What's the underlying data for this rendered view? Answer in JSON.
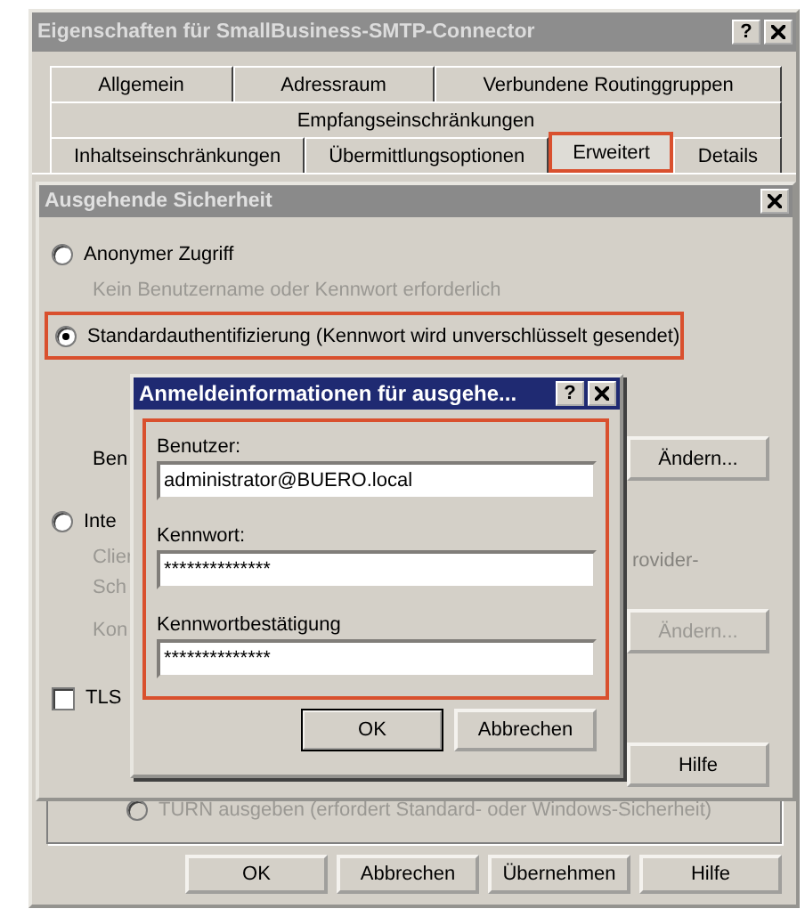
{
  "window": {
    "title": "Eigenschaften für SmallBusiness-SMTP-Connector",
    "help_button": "?"
  },
  "tab_rows": [
    [
      {
        "label": "Allgemein",
        "selected": false
      },
      {
        "label": "Adressraum",
        "selected": false
      },
      {
        "label": "Verbundene Routinggruppen",
        "selected": false
      }
    ],
    [
      {
        "label": "Empfangseinschränkungen",
        "selected": false
      }
    ],
    [
      {
        "label": "Inhaltseinschränkungen",
        "selected": false
      },
      {
        "label": "Übermittlungsoptionen",
        "selected": false
      },
      {
        "label": "Erweitert",
        "selected": true
      },
      {
        "label": "Details",
        "selected": false
      }
    ]
  ],
  "turn_option": {
    "label": "TURN ausgeben (erfordert Standard- oder Windows-Sicherheit)",
    "disabled": true
  },
  "buttons": [
    {
      "label": "OK"
    },
    {
      "label": "Abbrechen"
    },
    {
      "label": "Übernehmen"
    },
    {
      "label": "Hilfe"
    }
  ],
  "security_dialog": {
    "title": "Ausgehende Sicherheit",
    "anonymous": {
      "label": "Anonymer Zugriff",
      "selected": false,
      "description": "Kein Benutzername oder Kennwort erforderlich"
    },
    "basic": {
      "label": "Standardauthentifizierung (Kennwort wird unverschlüsselt gesendet)",
      "selected": true
    },
    "basic_user_label": "Ben",
    "integrated": {
      "label": "Inte",
      "selected": false,
      "description_lines": [
        "Clier",
        "Sch"
      ],
      "description_tail": "rovider-"
    },
    "account_label": "Kon",
    "tls": {
      "label": "TLS",
      "checked": false
    },
    "change_buttons": [
      {
        "label": "Ändern...",
        "disabled": false
      },
      {
        "label": "Ändern...",
        "disabled": true
      }
    ],
    "help_button": "Hilfe"
  },
  "credentials_dialog": {
    "title": "Anmeldeinformationen für ausgehe...",
    "help_button": "?",
    "fields": [
      {
        "label": "Benutzer:",
        "value": "administrator@BUERO.local"
      },
      {
        "label": "Kennwort:",
        "value": "**************"
      },
      {
        "label": "Kennwortbestätigung",
        "value": "**************"
      }
    ],
    "buttons": [
      {
        "label": "OK",
        "default": true
      },
      {
        "label": "Abbrechen",
        "default": false
      }
    ]
  }
}
